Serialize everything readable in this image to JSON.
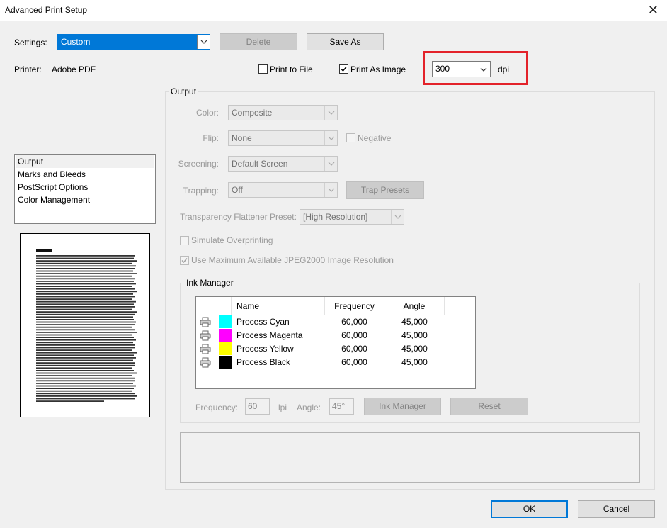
{
  "window": {
    "title": "Advanced Print Setup"
  },
  "settings": {
    "label": "Settings:",
    "value": "Custom"
  },
  "buttons": {
    "delete": "Delete",
    "save_as": "Save As",
    "trap_presets": "Trap Presets",
    "ink_manager": "Ink Manager",
    "reset": "Reset",
    "ok": "OK",
    "cancel": "Cancel"
  },
  "printer": {
    "label": "Printer:",
    "value": "Adobe PDF"
  },
  "print_to_file": {
    "label": "Print to File",
    "checked": false
  },
  "print_as_image": {
    "label": "Print As Image",
    "checked": true
  },
  "resolution": {
    "value": "300",
    "unit": "dpi"
  },
  "categories": [
    "Output",
    "Marks and Bleeds",
    "PostScript Options",
    "Color Management"
  ],
  "selected_category": "Output",
  "output": {
    "group_label": "Output",
    "color_label": "Color:",
    "color_value": "Composite",
    "flip_label": "Flip:",
    "flip_value": "None",
    "negative_label": "Negative",
    "screening_label": "Screening:",
    "screening_value": "Default Screen",
    "trapping_label": "Trapping:",
    "trapping_value": "Off",
    "flattener_label": "Transparency Flattener Preset:",
    "flattener_value": "[High Resolution]",
    "simulate_label": "Simulate Overprinting",
    "simulate_checked": false,
    "jpeg_label": "Use Maximum Available JPEG2000 Image Resolution",
    "jpeg_checked": true
  },
  "ink_manager": {
    "group_label": "Ink Manager",
    "columns": [
      "Name",
      "Frequency",
      "Angle"
    ],
    "rows": [
      {
        "name": "Process Cyan",
        "frequency": "60,000",
        "angle": "45,000",
        "color": "#00ffff"
      },
      {
        "name": "Process Magenta",
        "frequency": "60,000",
        "angle": "45,000",
        "color": "#ff00ff"
      },
      {
        "name": "Process Yellow",
        "frequency": "60,000",
        "angle": "45,000",
        "color": "#ffff00"
      },
      {
        "name": "Process Black",
        "frequency": "60,000",
        "angle": "45,000",
        "color": "#000000"
      }
    ],
    "frequency_label": "Frequency:",
    "frequency_value": "60",
    "lpi_label": "lpi",
    "angle_label": "Angle:",
    "angle_value": "45°"
  },
  "colors": {
    "accent": "#0078d7",
    "highlight": "#e3222a"
  }
}
